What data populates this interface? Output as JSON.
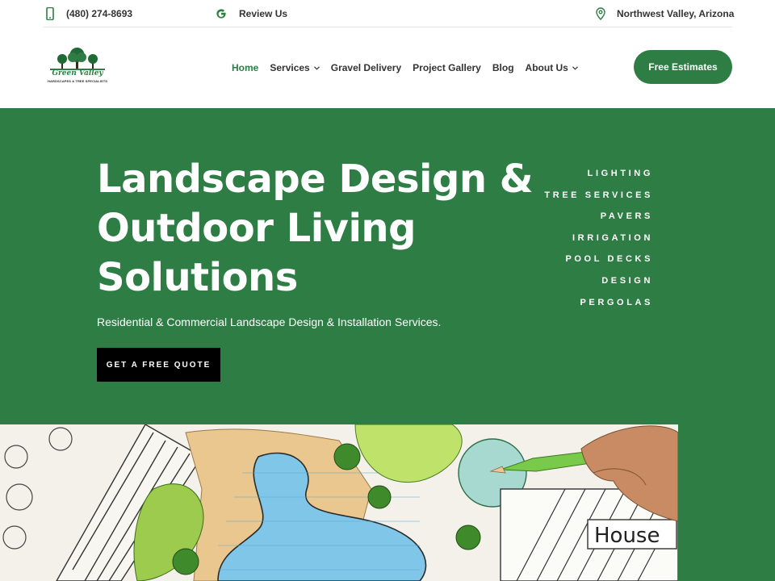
{
  "topbar": {
    "phone": "(480) 274-8693",
    "phone_icon": "phone-icon",
    "review": "Review Us",
    "review_icon": "google-icon",
    "location": "Northwest Valley, Arizona",
    "location_icon": "map-pin-icon"
  },
  "header": {
    "logo": {
      "name": "Green Valley",
      "tagline": "HARDSCAPES & TREE SPECIALISTS",
      "icon": "trees-logo-icon"
    },
    "nav": [
      {
        "label": "Home",
        "active": true,
        "dropdown": false
      },
      {
        "label": "Services",
        "active": false,
        "dropdown": true
      },
      {
        "label": "Gravel Delivery",
        "active": false,
        "dropdown": false
      },
      {
        "label": "Project Gallery",
        "active": false,
        "dropdown": false
      },
      {
        "label": "Blog",
        "active": false,
        "dropdown": false
      },
      {
        "label": "About Us",
        "active": false,
        "dropdown": true
      }
    ],
    "cta": "Free Estimates"
  },
  "hero": {
    "title_lines": [
      "Landscape Design &",
      "Outdoor Living",
      "Solutions"
    ],
    "subtitle": "Residential & Commercial Landscape Design & Installation Services.",
    "button": "GET A FREE QUOTE",
    "services": [
      "LIGHTING",
      "TREE SERVICES",
      "PAVERS",
      "IRRIGATION",
      "POOL DECKS",
      "DESIGN",
      "PERGOLAS"
    ],
    "image_label": "House"
  },
  "colors": {
    "brand_green": "#2e7d45",
    "button_black": "#000000",
    "text_dark": "#333333"
  }
}
